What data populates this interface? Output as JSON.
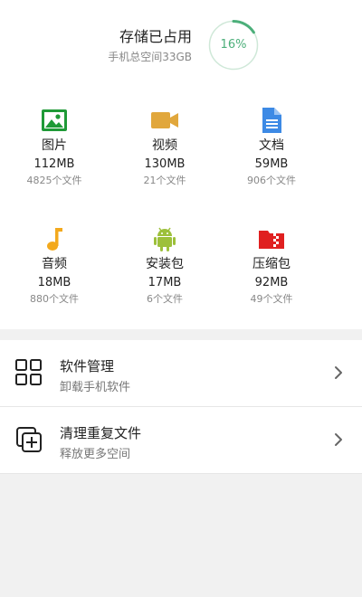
{
  "storage": {
    "title": "存储已占用",
    "subtitle": "手机总空间33GB",
    "percent_label": "16%",
    "percent": 0.16,
    "accent": "#4caf7a"
  },
  "categories": [
    {
      "name": "图片",
      "size": "112MB",
      "count": "4825个文件",
      "icon": "image-icon",
      "color": "#1f9a37"
    },
    {
      "name": "视频",
      "size": "130MB",
      "count": "21个文件",
      "icon": "video-icon",
      "color": "#e1a73c"
    },
    {
      "name": "文档",
      "size": "59MB",
      "count": "906个文件",
      "icon": "document-icon",
      "color": "#3d8ae5"
    },
    {
      "name": "音频",
      "size": "18MB",
      "count": "880个文件",
      "icon": "music-icon",
      "color": "#f3a91d"
    },
    {
      "name": "安装包",
      "size": "17MB",
      "count": "6个文件",
      "icon": "android-icon",
      "color": "#9dc03b"
    },
    {
      "name": "压缩包",
      "size": "92MB",
      "count": "49个文件",
      "icon": "zip-icon",
      "color": "#e02020"
    }
  ],
  "list": [
    {
      "title": "软件管理",
      "subtitle": "卸载手机软件",
      "icon": "apps-grid-icon"
    },
    {
      "title": "清理重复文件",
      "subtitle": "释放更多空间",
      "icon": "duplicate-add-icon"
    }
  ]
}
